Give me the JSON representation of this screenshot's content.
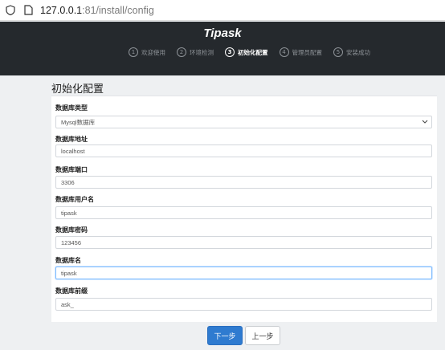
{
  "browser": {
    "url_host": "127.0.0.1",
    "url_rest": ":81/install/config"
  },
  "header": {
    "brand": "Tipask",
    "steps": [
      {
        "num": "1",
        "label": "欢迎使用"
      },
      {
        "num": "2",
        "label": "环境检测"
      },
      {
        "num": "3",
        "label": "初始化配置"
      },
      {
        "num": "4",
        "label": "管理员配置"
      },
      {
        "num": "5",
        "label": "安装成功"
      }
    ],
    "active_step": 3
  },
  "page": {
    "title": "初始化配置"
  },
  "form": {
    "db_type_label": "数据库类型",
    "db_type_value": "Mysql数据库",
    "db_host_label": "数据库地址",
    "db_host_value": "localhost",
    "db_port_label": "数据库端口",
    "db_port_value": "3306",
    "db_user_label": "数据库用户名",
    "db_user_value": "tipask",
    "db_password_label": "数据库密码",
    "db_password_value": "123456",
    "db_name_label": "数据库名",
    "db_name_value": "tipask",
    "db_prefix_label": "数据库前缀",
    "db_prefix_value": "ask_"
  },
  "buttons": {
    "next": "下一步",
    "prev": "上一步"
  },
  "colors": {
    "header_bg": "#25292d",
    "primary": "#2f7bd0",
    "focus": "#80bdff"
  }
}
